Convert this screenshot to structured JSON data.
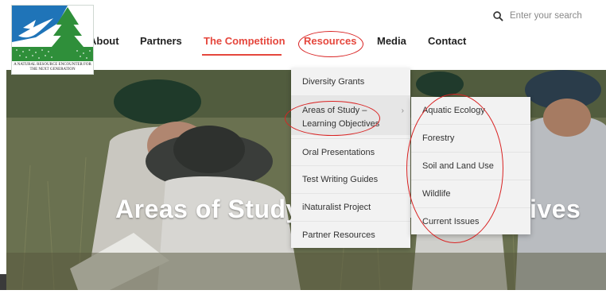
{
  "logo": {
    "tagline": "A NATURAL RESOURCE ENCOUNTER FOR THE NEXT GENERATION",
    "colors": {
      "sky": "#1f74b8",
      "tree": "#2f8f3a",
      "bird": "#ffffff"
    }
  },
  "nav": {
    "items": [
      {
        "label": "About"
      },
      {
        "label": "Partners"
      },
      {
        "label": "The Competition"
      },
      {
        "label": "Resources"
      },
      {
        "label": "Media"
      },
      {
        "label": "Contact"
      }
    ]
  },
  "search": {
    "placeholder": "Enter your search",
    "icon": "search-icon"
  },
  "hero": {
    "title": "Areas of Study – Learning Objectives"
  },
  "resources_menu": {
    "items": [
      {
        "label": "Diversity Grants"
      },
      {
        "label": "Areas of Study – Learning Objectives",
        "line1": "Areas of Study –",
        "line2": "Learning Objectives",
        "has_submenu": true
      },
      {
        "label": "Oral Presentations"
      },
      {
        "label": "Test Writing Guides"
      },
      {
        "label": "iNaturalist Project"
      },
      {
        "label": "Partner Resources"
      }
    ],
    "submenu_arrow": "›"
  },
  "submenu": {
    "items": [
      {
        "label": "Aquatic Ecology"
      },
      {
        "label": "Forestry"
      },
      {
        "label": "Soil and Land Use"
      },
      {
        "label": "Wildlife"
      },
      {
        "label": "Current Issues"
      }
    ]
  },
  "colors": {
    "accent": "#e5473d",
    "annotation": "#d92323",
    "menu_bg": "#f2f2f2"
  }
}
